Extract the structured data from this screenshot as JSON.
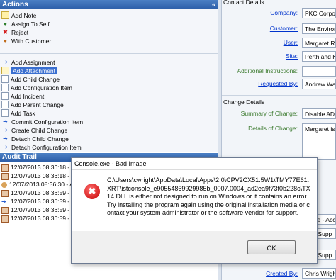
{
  "actions": {
    "header": "Actions",
    "collapse_glyph": "«",
    "group1": [
      "Add Note",
      "Assign To Self",
      "Reject",
      "With Customer"
    ],
    "group2": [
      "Add Assignment",
      "Add Attachment",
      "Add Child Change",
      "Add Configuration Item",
      "Add Incident",
      "Add Parent Change",
      "Add Task",
      "Commit Configuration Item",
      "Create Child Change",
      "Detach Child Change",
      "Detach Configuration Item"
    ]
  },
  "audit": {
    "header": "Audit Trail",
    "rows": [
      "12/07/2013 08:36:18 - A",
      "12/07/2013 08:36:18 - A",
      "12/07/2013 08:36:30 - A",
      "12/07/2013 08:36:59 - A",
      "12/07/2013 08:36:59 - A",
      "12/07/2013 08:36:59 - A",
      "12/07/2013 08:36:59 - A"
    ]
  },
  "contact": {
    "section": "Contact Details",
    "company_label": "Company:",
    "company_value": "PKC Corporat",
    "customer_label": "Customer:",
    "customer_value": "The Environm",
    "user_label": "User:",
    "user_value": "Margaret Ro",
    "site_label": "Site:",
    "site_value": "Perth and Kin",
    "instructions_label": "Additional Instructions:",
    "instructions_value": "",
    "requested_label": "Requested By:",
    "requested_value": "Andrew War"
  },
  "change": {
    "section": "Change Details",
    "summary_label": "Summary of Change:",
    "summary_value": "Disable AD A",
    "details_label": "Details of Change:",
    "details_value": "Margaret is"
  },
  "right_extra": {
    "field1": "Stage - Acc",
    "field2": "Line Supp",
    "field3": "Line Supp",
    "created_label": "Created By:",
    "created_value": "Chris Wright"
  },
  "dialog": {
    "title": "Console.exe - Bad Image",
    "message": "C:\\Users\\cwright\\AppData\\Local\\Apps\\2.0\\CPV2CX51.5W1\\TMY77E61.XRT\\istconsole_e90554869929985b_0007.0004_ad2ea9f73f0b228c\\TX14.DLL is either not designed to run on Windows or it contains an error. Try installing the program again using the original installation media or contact your system administrator or the software vendor for support.",
    "ok_label": "OK",
    "error_glyph": "✖"
  }
}
